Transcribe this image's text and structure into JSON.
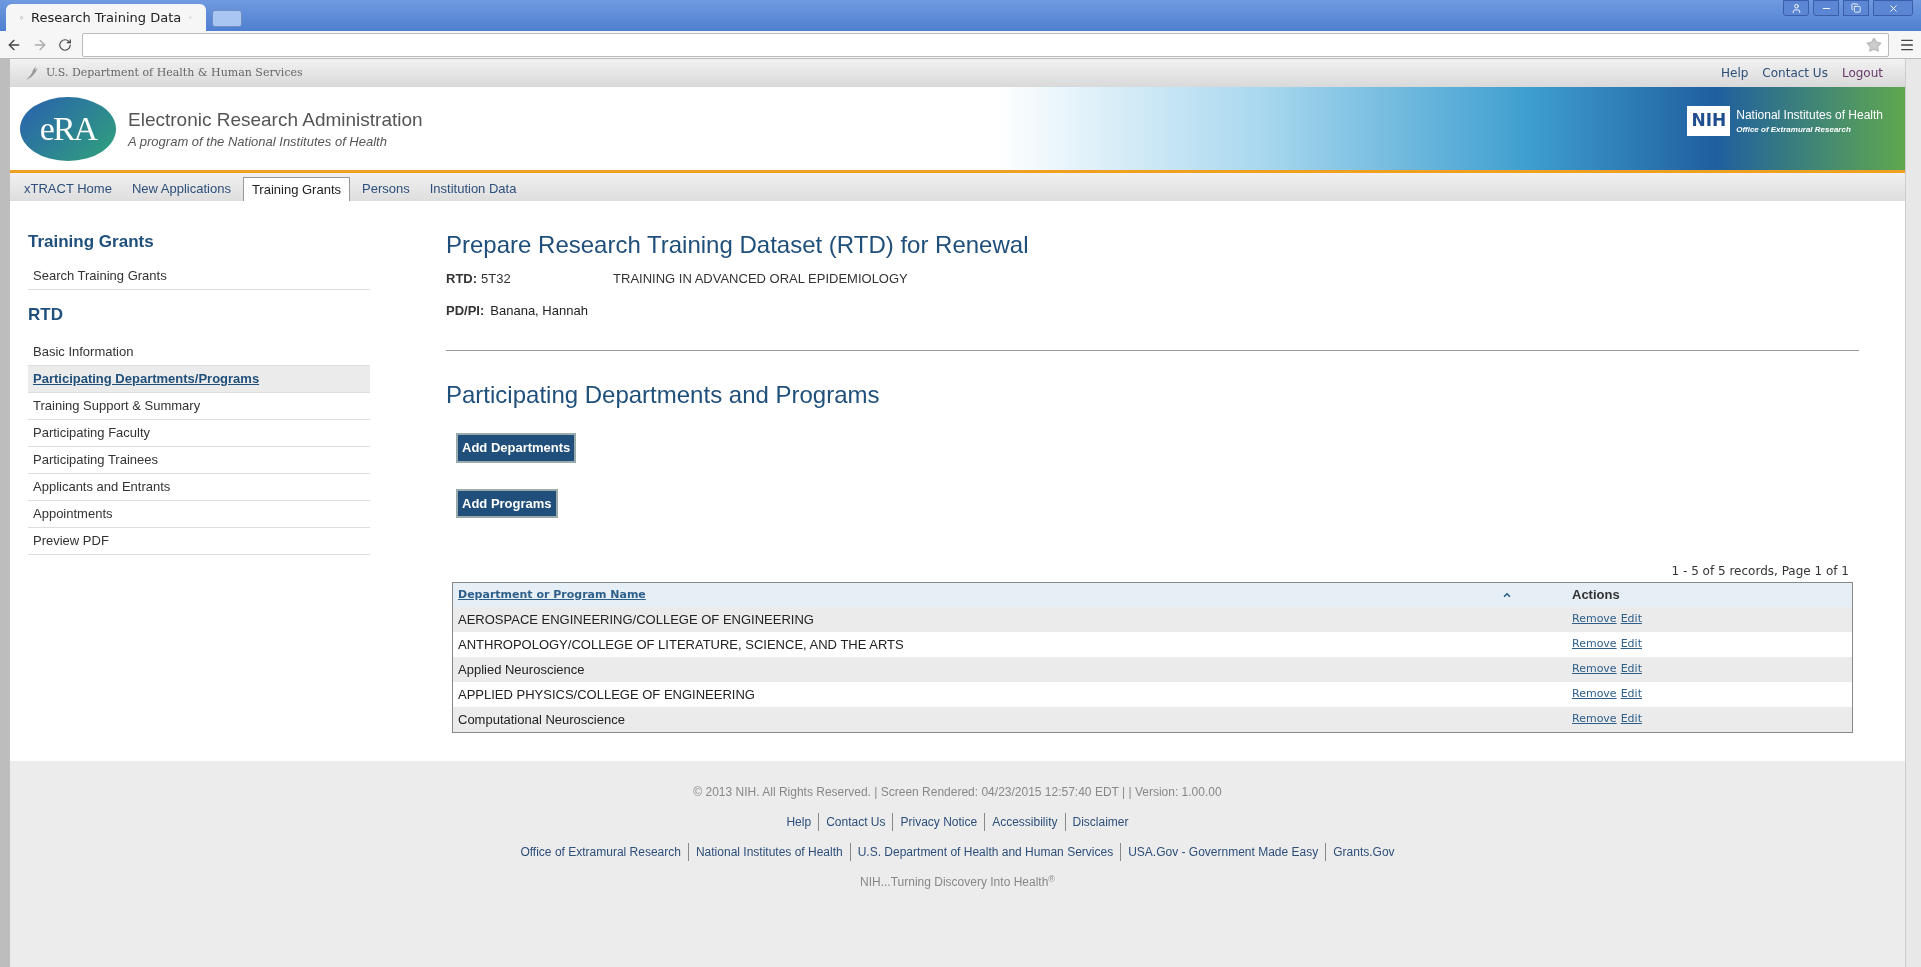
{
  "browser": {
    "tab_title": "Research Training Data"
  },
  "gov_bar": {
    "title": "U.S. Department of Health & Human Services",
    "links": [
      "Help",
      "Contact Us",
      "Logout"
    ]
  },
  "header": {
    "logo": "eRA",
    "title": "Electronic Research Administration",
    "subtitle": "A program of the National Institutes of Health",
    "nih_logo": "NIH",
    "nih_title": "National Institutes of Health",
    "nih_subtitle": "Office of  Extramural Research"
  },
  "nav_tabs": [
    {
      "label": "xTRACT Home",
      "selected": false
    },
    {
      "label": "New Applications",
      "selected": false
    },
    {
      "label": "Training Grants",
      "selected": true
    },
    {
      "label": "Persons",
      "selected": false
    },
    {
      "label": "Institution Data",
      "selected": false
    }
  ],
  "sidebar": {
    "heading": "Training Grants",
    "top_items": [
      {
        "label": "Search Training Grants",
        "selected": false
      }
    ],
    "section": "RTD",
    "items": [
      {
        "label": "Basic Information",
        "selected": false
      },
      {
        "label": "Participating Departments/Programs",
        "selected": true
      },
      {
        "label": "Training Support & Summary",
        "selected": false
      },
      {
        "label": "Participating Faculty",
        "selected": false
      },
      {
        "label": "Participating Trainees",
        "selected": false
      },
      {
        "label": "Applicants and Entrants",
        "selected": false
      },
      {
        "label": "Appointments",
        "selected": false
      },
      {
        "label": "Preview PDF",
        "selected": false
      }
    ]
  },
  "main": {
    "title": "Prepare Research Training Dataset (RTD) for Renewal",
    "rtd_label": "RTD:",
    "rtd_value": "5T32",
    "rtd_name": "TRAINING IN ADVANCED ORAL EPIDEMIOLOGY",
    "pi_label": "PD/PI:",
    "pi_value": "Banana, Hannah",
    "section_title": "Participating Departments and Programs",
    "buttons": [
      "Add Departments",
      "Add Programs"
    ]
  },
  "table": {
    "summary": "1 - 5 of 5 records, Page 1 of 1",
    "columns": [
      "Department or Program Name",
      "Actions"
    ],
    "rows": [
      {
        "name": "AEROSPACE ENGINEERING/COLLEGE OF ENGINEERING",
        "actions": [
          "Remove",
          "Edit"
        ]
      },
      {
        "name": "ANTHROPOLOGY/COLLEGE OF LITERATURE, SCIENCE, AND THE ARTS",
        "actions": [
          "Remove",
          "Edit"
        ]
      },
      {
        "name": "Applied Neuroscience",
        "actions": [
          "Remove",
          "Edit"
        ]
      },
      {
        "name": "APPLIED PHYSICS/COLLEGE OF ENGINEERING",
        "actions": [
          "Remove",
          "Edit"
        ]
      },
      {
        "name": "Computational Neuroscience",
        "actions": [
          "Remove",
          "Edit"
        ]
      }
    ]
  },
  "footer": {
    "copyright": "© 2013 NIH. All Rights Reserved. | Screen Rendered: 04/23/2015 12:57:40 EDT | | Version: 1.00.00",
    "links": [
      "Help",
      "Contact Us",
      "Privacy Notice",
      "Accessibility",
      "Disclaimer"
    ],
    "external_links": [
      "Office of Extramural Research",
      "National Institutes of Health",
      "U.S. Department of Health and Human Services",
      "USA.Gov - Government Made Easy",
      "Grants.Gov"
    ],
    "tagline": "NIH...Turning Discovery Into Health$^{®}$"
  }
}
